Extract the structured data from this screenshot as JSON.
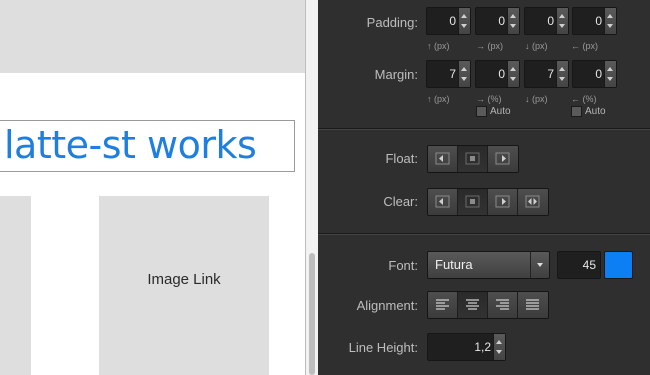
{
  "canvas": {
    "title": "latte-st works",
    "tile_label": "Image Link"
  },
  "panel": {
    "padding": {
      "label": "Padding:",
      "fields": [
        {
          "value": "0",
          "unit": "↑ (px)"
        },
        {
          "value": "0",
          "unit": "→ (px)"
        },
        {
          "value": "0",
          "unit": "↓ (px)"
        },
        {
          "value": "0",
          "unit": "← (px)"
        }
      ]
    },
    "margin": {
      "label": "Margin:",
      "fields": [
        {
          "value": "7",
          "unit": "↑ (px)"
        },
        {
          "value": "0",
          "unit": "→ (%)"
        },
        {
          "value": "7",
          "unit": "↓ (px)"
        },
        {
          "value": "0",
          "unit": "← (%)"
        }
      ],
      "auto_label": "Auto"
    },
    "float": {
      "label": "Float:",
      "options": [
        "float-left",
        "float-none",
        "float-right"
      ],
      "selected": 1
    },
    "clear": {
      "label": "Clear:",
      "options": [
        "clear-left",
        "clear-none",
        "clear-right",
        "clear-both"
      ],
      "selected": 1
    },
    "font": {
      "label": "Font:",
      "family": "Futura",
      "size": "45",
      "color": "#0d7ff5"
    },
    "alignment": {
      "label": "Alignment:",
      "options": [
        "align-left",
        "align-center",
        "align-right",
        "align-justify"
      ],
      "selected": 1
    },
    "line_height": {
      "label": "Line Height:",
      "value": "1,2"
    }
  }
}
